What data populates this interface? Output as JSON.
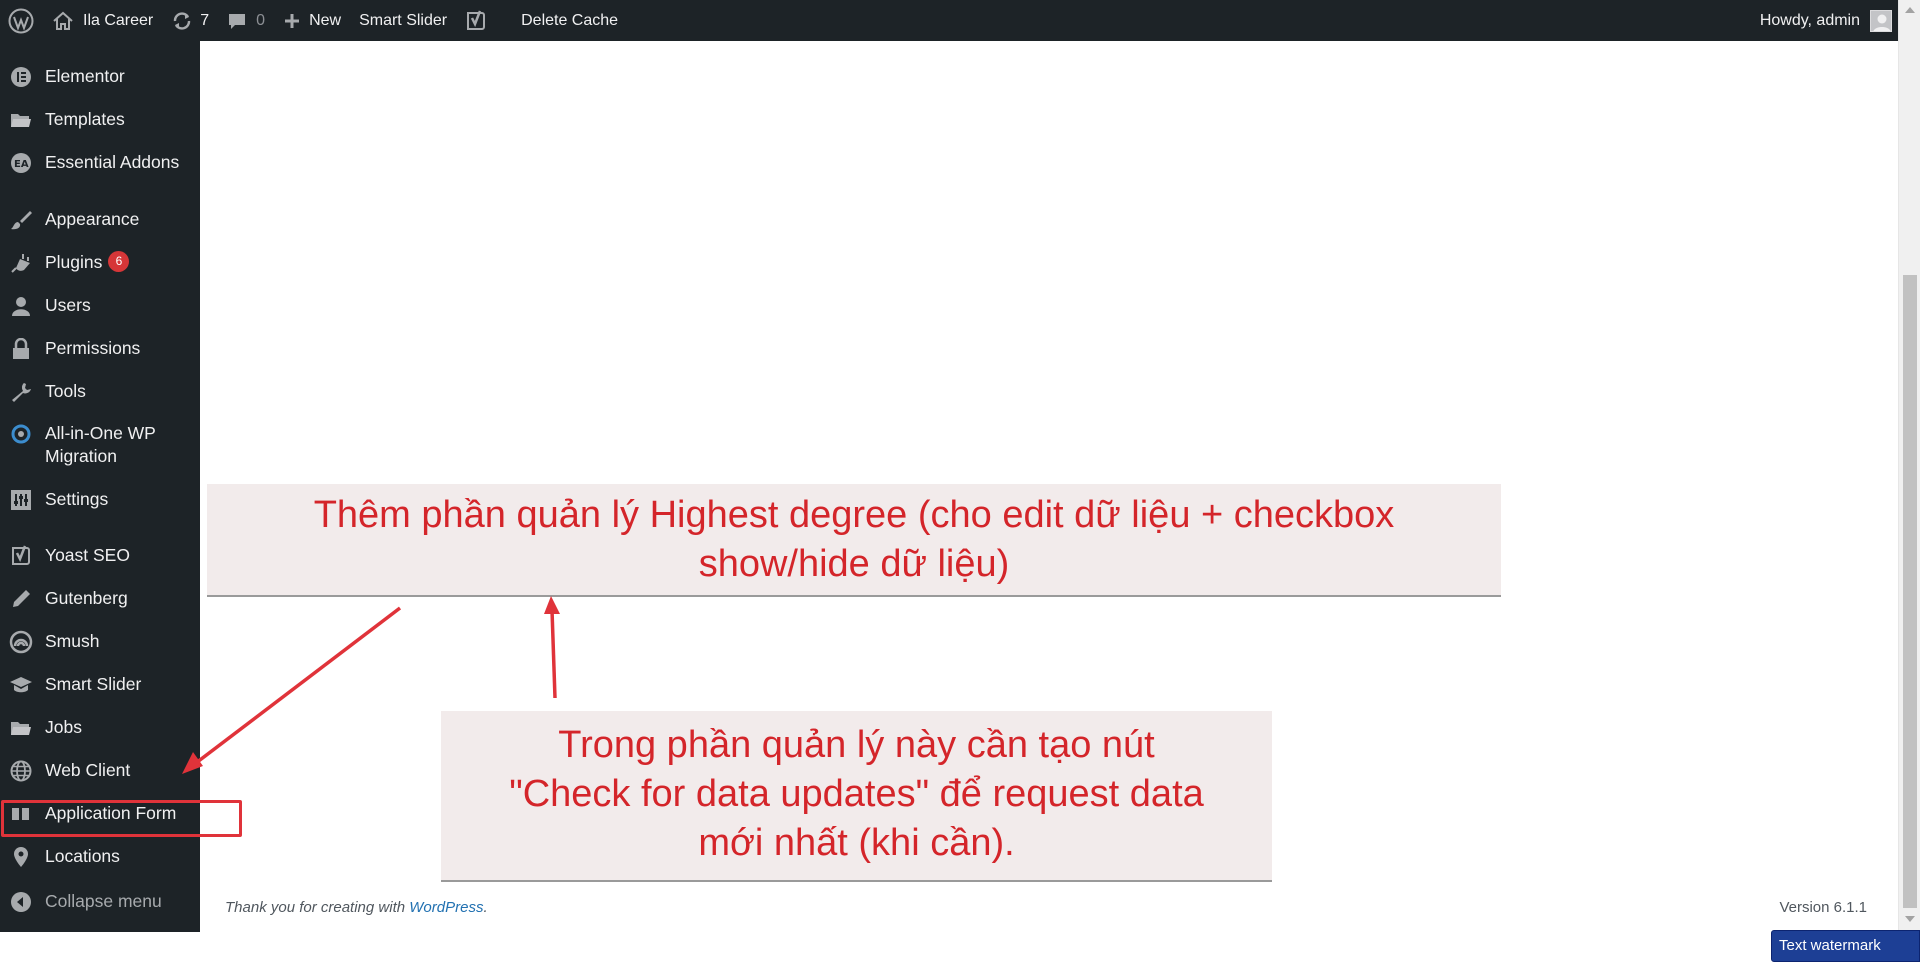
{
  "adminbar": {
    "site_name": "Ila Career",
    "updates_count": "7",
    "comments_count": "0",
    "new_label": "New",
    "smart_slider_label": "Smart Slider",
    "delete_cache_label": "Delete Cache",
    "howdy_label": "Howdy, admin"
  },
  "sidebar": {
    "items": [
      {
        "label": "Elementor",
        "icon": "elementor-icon"
      },
      {
        "label": "Templates",
        "icon": "folder-icon"
      },
      {
        "label": "Essential Addons",
        "icon": "essential-addons-icon"
      },
      {
        "label": "Appearance",
        "icon": "paintbrush-icon"
      },
      {
        "label": "Plugins",
        "icon": "plug-icon",
        "badge": "6"
      },
      {
        "label": "Users",
        "icon": "user-icon"
      },
      {
        "label": "Permissions",
        "icon": "lock-icon"
      },
      {
        "label": "Tools",
        "icon": "wrench-icon"
      },
      {
        "label": "All-in-One WP",
        "label2": "Migration",
        "icon": "migration-icon"
      },
      {
        "label": "Settings",
        "icon": "settings-icon"
      },
      {
        "label": "Yoast SEO",
        "icon": "yoast-icon"
      },
      {
        "label": "Gutenberg",
        "icon": "pencil-icon"
      },
      {
        "label": "Smush",
        "icon": "smush-icon"
      },
      {
        "label": "Smart Slider",
        "icon": "graduation-cap-icon"
      },
      {
        "label": "Jobs",
        "icon": "folder-open-icon"
      },
      {
        "label": "Web Client",
        "icon": "globe-icon"
      },
      {
        "label": "Application Form",
        "icon": "columns-icon"
      },
      {
        "label": "Locations",
        "icon": "location-pin-icon"
      }
    ],
    "collapse_label": "Collapse menu"
  },
  "annotations": {
    "note1_line1": "Thêm phần quản lý Highest degree (cho edit dữ liệu + checkbox",
    "note1_line2": "show/hide dữ liệu)",
    "note2_line1": "Trong phần quản lý này cần tạo nút",
    "note2_line2": "\"Check for data updates\" để request data",
    "note2_line3": "mới nhất (khi cần).",
    "color": "#d4252a"
  },
  "footer": {
    "thanks_text": "Thank you for creating with ",
    "wordpress_link": "WordPress",
    "period": ".",
    "version": "Version 6.1.1"
  },
  "watermark": {
    "label": "Text watermark"
  },
  "colors": {
    "admin_bg": "#1d2327",
    "menu_text": "#f0f0f1",
    "badge": "#d63638",
    "annotation_red": "#d4252a",
    "link": "#2271b1"
  }
}
